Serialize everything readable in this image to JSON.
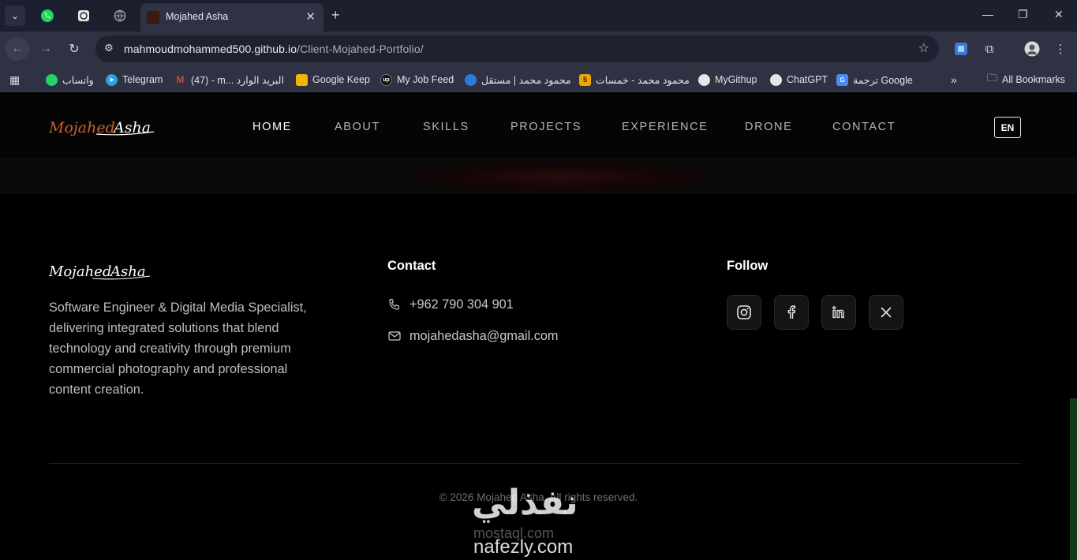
{
  "browser": {
    "active_tab_title": "Mojahed Asha",
    "url_host": "mahmoudmohammed500.github.io",
    "url_path": "/Client-Mojahed-Portfolio/",
    "bookmarks": [
      {
        "label": "واتساب",
        "icon": "whatsapp-icon",
        "color": "#25d366"
      },
      {
        "label": "Telegram",
        "icon": "telegram-icon",
        "color": "#2aa3df"
      },
      {
        "label": "(47) - m... البريد الوارد",
        "icon": "gmail-icon",
        "color": "#d44638"
      },
      {
        "label": "Google Keep",
        "icon": "keep-icon",
        "color": "#f6b400"
      },
      {
        "label": "My Job Feed",
        "icon": "upwork-icon",
        "color": "#111111"
      },
      {
        "label": "محمود محمد | مستقل",
        "icon": "mostaql-icon",
        "color": "#2c7be5"
      },
      {
        "label": "محمود محمد - خمسات",
        "icon": "khamsat-icon",
        "color": "#f2a400"
      },
      {
        "label": "MyGithup",
        "icon": "github-icon",
        "color": "#e6e6e6"
      },
      {
        "label": "ChatGPT",
        "icon": "chatgpt-icon",
        "color": "#e6e6e6"
      },
      {
        "label": "ترجمة Google",
        "icon": "translate-icon",
        "color": "#4a8af4"
      }
    ],
    "all_bookmarks_label": "All Bookmarks"
  },
  "site": {
    "nav": {
      "links": [
        "HOME",
        "ABOUT",
        "SKILLS",
        "PROJECTS",
        "EXPERIENCE",
        "DRONE",
        "CONTACT"
      ],
      "lang": "EN"
    },
    "footer": {
      "about": "Software Engineer & Digital Media Specialist, delivering integrated solutions that blend technology and creativity through premium commercial photography and professional content creation.",
      "contact_heading": "Contact",
      "phone": "+962 790 304 901",
      "email": "mojahedasha@gmail.com",
      "follow_heading": "Follow",
      "socials": [
        "instagram-icon",
        "facebook-icon",
        "linkedin-icon",
        "x-icon"
      ],
      "copyright": "© 2026 Mojahed Asha. All rights reserved."
    },
    "watermark": {
      "arabic": "نفذلي",
      "domain1": "mostaql.com",
      "domain2": "nafezly.com"
    },
    "colors": {
      "accent": "#c9622a",
      "background": "#000000"
    }
  }
}
